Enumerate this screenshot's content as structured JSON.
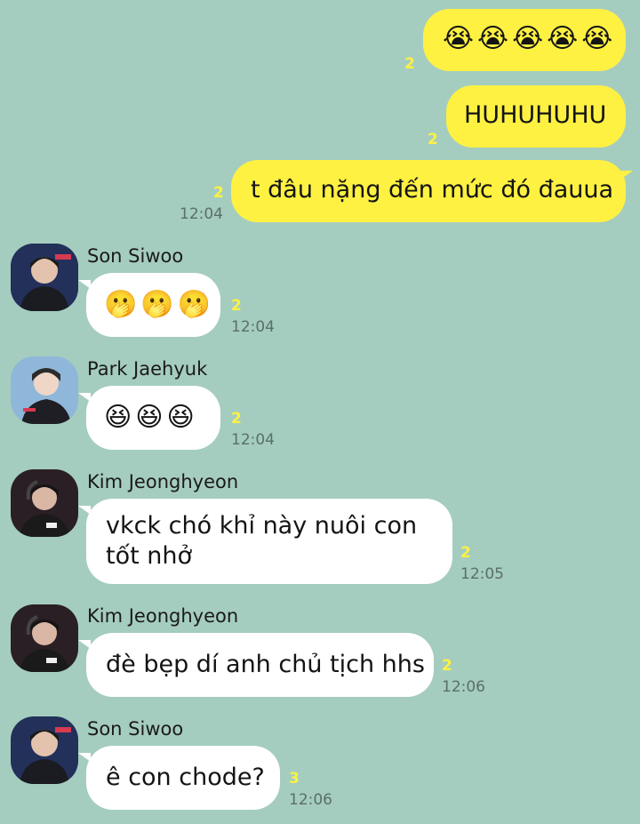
{
  "messages": [
    {
      "text": "😭😭😭😭😭",
      "unread": "2",
      "time": ""
    },
    {
      "text": "HUHUHUHU",
      "unread": "2",
      "time": ""
    },
    {
      "text": "t đâu nặng đến mức đó đauua",
      "unread": "2",
      "time": "12:04"
    },
    {
      "sender": "Son Siwoo",
      "avatar": "avatar-son-siwoo",
      "text": "🫢🫢🫢",
      "unread": "2",
      "time": "12:04"
    },
    {
      "sender": "Park Jaehyuk",
      "avatar": "avatar-park-jaehyuk",
      "text": "😆😆😆",
      "unread": "2",
      "time": "12:04"
    },
    {
      "sender": "Kim Jeonghyeon",
      "avatar": "avatar-kim-jeonghyeon",
      "line1": "vkck chó khỉ này nuôi con",
      "line2": "tốt nhở",
      "unread": "2",
      "time": "12:05"
    },
    {
      "sender": "Kim Jeonghyeon",
      "avatar": "avatar-kim-jeonghyeon",
      "text": "đè bẹp dí anh chủ tịch hhs",
      "unread": "2",
      "time": "12:06"
    },
    {
      "sender": "Son Siwoo",
      "avatar": "avatar-son-siwoo",
      "text": "ê con chode?",
      "unread": "3",
      "time": "12:06"
    }
  ],
  "colors": {
    "background": "#a5cdbf",
    "outgoing_bubble": "#fef142",
    "incoming_bubble": "#ffffff",
    "unread_count": "#fef142"
  }
}
